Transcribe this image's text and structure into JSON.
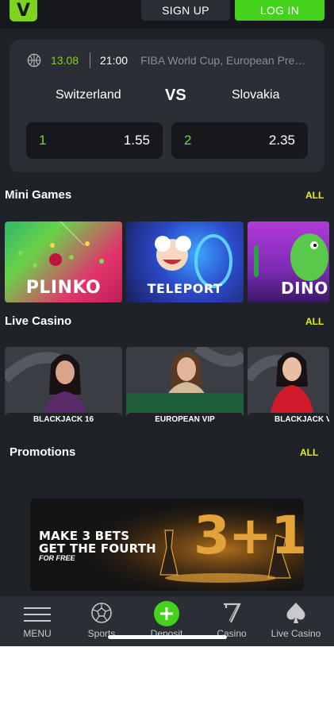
{
  "header": {
    "logo": "V",
    "signup_label": "SIGN UP",
    "login_label": "LOG IN"
  },
  "match": {
    "icon": "basketball-icon",
    "date": "13.08",
    "time": "21:00",
    "league": "FIBA World Cup, European Pre-Qualifiers",
    "team_home": "Switzerland",
    "vs": "VS",
    "team_away": "Slovakia",
    "odds": [
      {
        "label": "1",
        "value": "1.55"
      },
      {
        "label": "2",
        "value": "2.35"
      }
    ]
  },
  "mini_games": {
    "title": "Mini Games",
    "all_label": "ALL",
    "items": [
      {
        "label": "PLINKO"
      },
      {
        "label": "TELEPORT"
      },
      {
        "label": "DINO"
      }
    ]
  },
  "live_casino": {
    "title": "Live Casino",
    "all_label": "ALL",
    "items": [
      {
        "label": "BLACKJACK 16"
      },
      {
        "label": "EUROPEAN VIP"
      },
      {
        "label": "BLACKJACK VIP"
      }
    ]
  },
  "promotions": {
    "title": "Promotions",
    "all_label": "ALL",
    "banner": {
      "line1": "MAKE 3 BETS",
      "line2": "GET THE FOURTH",
      "line3": "FOR FREE",
      "big": "3+1"
    }
  },
  "nav": [
    {
      "label": "MENU",
      "icon": "menu-icon"
    },
    {
      "label": "Sports",
      "icon": "soccer-ball-icon"
    },
    {
      "label": "Deposit",
      "icon": "plus-icon"
    },
    {
      "label": "Casino",
      "icon": "seven-icon"
    },
    {
      "label": "Live Casino",
      "icon": "spade-icon"
    }
  ],
  "colors": {
    "accent_green": "#45d21c",
    "accent_yellow": "#e6f20a",
    "bg": "#1f2227",
    "card": "#2b2e34"
  }
}
